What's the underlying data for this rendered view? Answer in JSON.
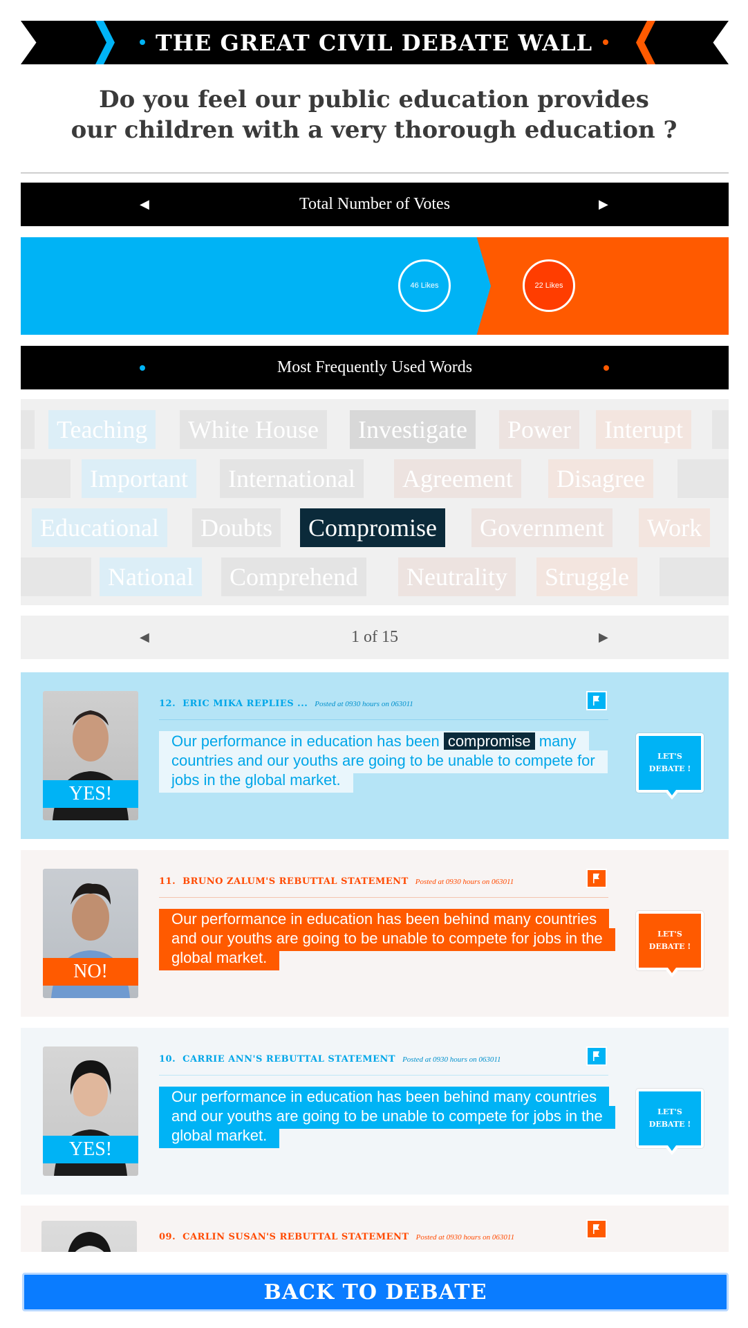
{
  "header": {
    "title": "THE GREAT CIVIL DEBATE WALL"
  },
  "question": {
    "line1": "Do you feel our public education provides",
    "line2": "our children with a very thorough education ?"
  },
  "votes": {
    "label": "Total Number of Votes",
    "yes_likes": "46 Likes",
    "no_likes": "22 Likes",
    "yes_share": 0.664
  },
  "words": {
    "label": "Most Frequently Used Words",
    "row1": [
      "Teaching",
      "White House",
      "Investigate",
      "Power",
      "Interupt"
    ],
    "row2": [
      "Important",
      "International",
      "Agreement",
      "Disagree"
    ],
    "row3": [
      "Educational",
      "Doubts",
      "Compromise",
      "Government",
      "Work"
    ],
    "row4": [
      "National",
      "Comprehend",
      "Neutrality",
      "Struggle"
    ],
    "selected": "Compromise"
  },
  "pager": {
    "text": "1 of 15"
  },
  "posts": [
    {
      "num": "12.",
      "who": "ERIC MIKA REPLIES ...",
      "posted": "Posted at 0930 hours on 063011",
      "vote": "YES!",
      "text_before": "Our performance in education has been",
      "highlight": "compromise",
      "text_after": "many countries and our youths are going to be unable to compete for jobs in the global market."
    },
    {
      "num": "11.",
      "who": "BRUNO ZALUM'S REBUTTAL STATEMENT",
      "posted": "Posted at 0930 hours on 063011",
      "vote": "NO!",
      "text": "Our performance in education has been behind many countries and our youths are going to be unable to compete for jobs in the global market."
    },
    {
      "num": "10.",
      "who": "CARRIE ANN'S REBUTTAL STATEMENT",
      "posted": "Posted at 0930 hours on 063011",
      "vote": "YES!",
      "text": "Our performance in education has been behind many countries and our youths are going to be unable to compete for jobs in the global market."
    },
    {
      "num": "09.",
      "who": "CARLIN SUSAN'S REBUTTAL STATEMENT",
      "posted": "Posted at 0930 hours on 063011"
    }
  ],
  "debate_button": {
    "line1": "LET'S",
    "line2": "DEBATE !"
  },
  "back_button": "BACK TO DEBATE",
  "colors": {
    "blue": "#00b3f5",
    "orange": "#ff5a00",
    "black": "#000000",
    "navy": "#0b2a3a"
  }
}
